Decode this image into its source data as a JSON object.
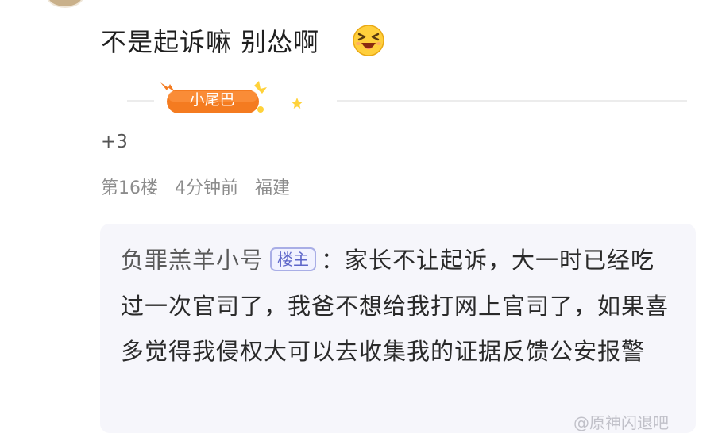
{
  "comment": {
    "text": "不是起诉嘛 别怂啊",
    "emoji_icon": "squinting-laughing-face-icon",
    "tail_badge": {
      "label": "小尾巴",
      "color": "#f47b20"
    },
    "reaction_count": "+3",
    "meta": {
      "floor": "第16楼",
      "time": "4分钟前",
      "location": "福建"
    }
  },
  "quote": {
    "author": "负罪羔羊小号",
    "author_badge": "楼主",
    "colon": "：",
    "text": "家长不让起诉，大一时已经吃过一次官司了，我爸不想给我打网上官司了，如果喜多觉得我侵权大可以去收集我的证据反馈公安报警"
  },
  "watermark": "@原神闪退吧",
  "colors": {
    "badge_orange": "#f47b20",
    "host_badge_border": "#a9aee6",
    "quote_bg": "#f6f6fb",
    "meta_gray": "#8c8c8c"
  }
}
